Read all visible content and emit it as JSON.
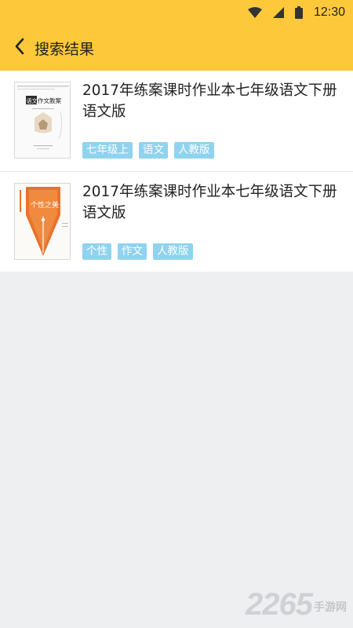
{
  "status_bar": {
    "time": "12:30",
    "icons": [
      "wifi-icon",
      "signal-icon",
      "battery-icon"
    ]
  },
  "app_bar": {
    "back_icon": "chevron-left-icon",
    "title": "搜索结果"
  },
  "colors": {
    "accent": "#fdc93a",
    "tag_bg": "#8fd3ef",
    "page_bg": "#eeeff1"
  },
  "results": [
    {
      "title": "2017年练案课时作业本七年级语文下册语文版",
      "cover": {
        "badge": "语文",
        "heading": "作文教案"
      },
      "tags": [
        "七年级上",
        "语文",
        "人教版"
      ]
    },
    {
      "title": "2017年练案课时作业本七年级语文下册语文版",
      "cover": {
        "heading": "个性之美"
      },
      "tags": [
        "个性",
        "作文",
        "人教版"
      ]
    }
  ],
  "watermark": {
    "number": "2265",
    "text": "手游网"
  }
}
